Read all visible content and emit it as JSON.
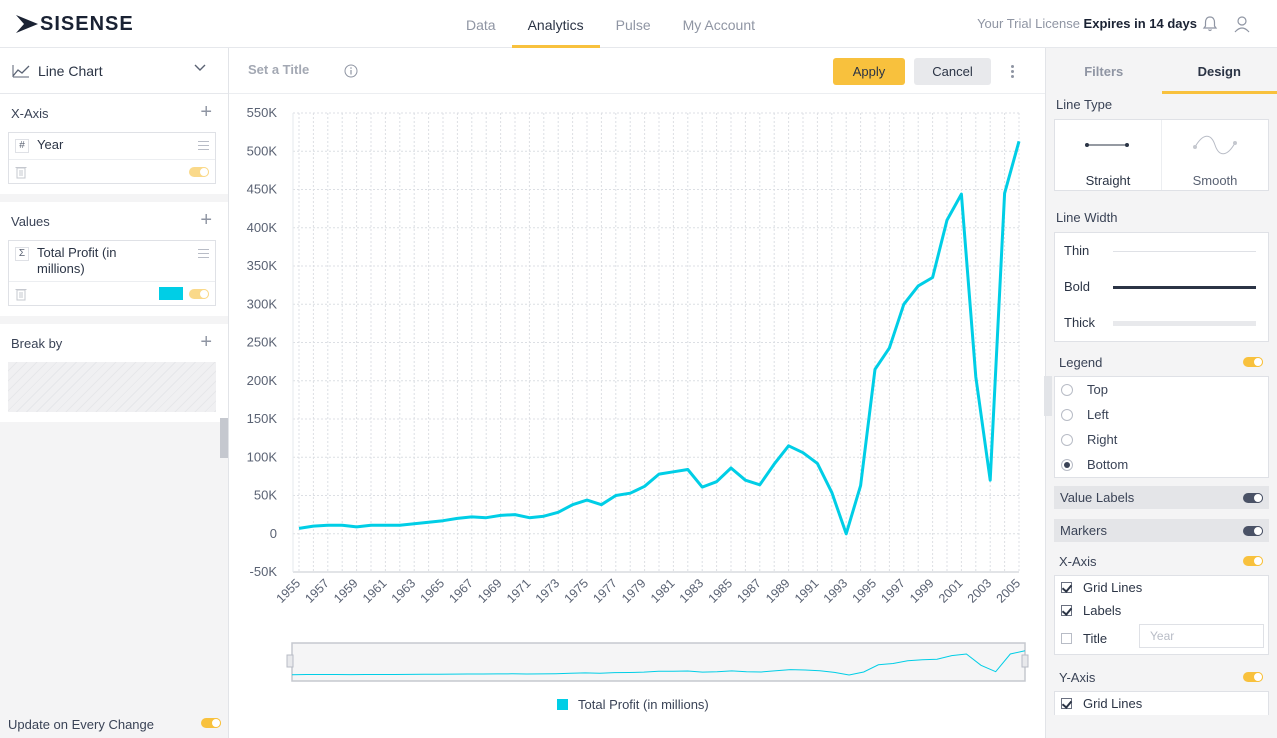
{
  "app": {
    "logo_text": "SISENSE",
    "nav": [
      "Data",
      "Analytics",
      "Pulse",
      "My Account"
    ],
    "active_nav": "Analytics",
    "license_prefix": "Your Trial License ",
    "license_bold": "Expires in 14 days"
  },
  "left": {
    "chart_type": "Line Chart",
    "xaxis_label": "X-Axis",
    "xaxis_field": "Year",
    "xaxis_field_type": "#",
    "values_label": "Values",
    "values_field": "Total Profit (in millions)",
    "values_field_type": "Σ",
    "series_color": "#00cee6",
    "breakby_label": "Break by",
    "update_label": "Update on Every Change"
  },
  "toolbar": {
    "title_placeholder": "Set a Title",
    "apply": "Apply",
    "cancel": "Cancel"
  },
  "design": {
    "tabs": [
      "Filters",
      "Design"
    ],
    "active_tab": "Design",
    "line_type_label": "Line Type",
    "line_types": [
      "Straight",
      "Smooth"
    ],
    "line_width_label": "Line Width",
    "line_widths": [
      "Thin",
      "Bold",
      "Thick"
    ],
    "selected_width": "Bold",
    "legend_label": "Legend",
    "legend_positions": [
      "Top",
      "Left",
      "Right",
      "Bottom"
    ],
    "legend_selected": "Bottom",
    "value_labels": "Value Labels",
    "markers": "Markers",
    "xaxis_label": "X-Axis",
    "xaxis_grid": "Grid Lines",
    "xaxis_labels": "Labels",
    "xaxis_title": "Title",
    "xaxis_title_placeholder": "Year",
    "yaxis_label": "Y-Axis",
    "yaxis_grid": "Grid Lines"
  },
  "chart_data": {
    "type": "line",
    "series": [
      {
        "name": "Total Profit (in millions)",
        "x": [
          1955,
          1956,
          1957,
          1958,
          1959,
          1960,
          1961,
          1962,
          1963,
          1964,
          1965,
          1966,
          1967,
          1968,
          1969,
          1970,
          1971,
          1972,
          1973,
          1974,
          1975,
          1976,
          1977,
          1978,
          1979,
          1980,
          1981,
          1982,
          1983,
          1984,
          1985,
          1986,
          1987,
          1988,
          1989,
          1990,
          1991,
          1992,
          1993,
          1994,
          1995,
          1996,
          1997,
          1998,
          1999,
          2000,
          2001,
          2002,
          2003,
          2004,
          2005
        ],
        "values": [
          7000,
          10000,
          11000,
          11000,
          9000,
          11000,
          11000,
          11000,
          13000,
          15000,
          17000,
          20000,
          22000,
          21000,
          24000,
          25000,
          21000,
          23000,
          28000,
          38000,
          44000,
          38000,
          50000,
          53000,
          62000,
          78000,
          81000,
          84000,
          61000,
          68000,
          86000,
          70000,
          64000,
          91000,
          115000,
          106000,
          92000,
          54000,
          0,
          63000,
          215000,
          243000,
          300000,
          324000,
          335000,
          410000,
          444000,
          205000,
          70000,
          445000,
          513000
        ]
      }
    ],
    "xticks": [
      "1955",
      "1957",
      "1959",
      "1961",
      "1963",
      "1965",
      "1967",
      "1969",
      "1971",
      "1973",
      "1975",
      "1977",
      "1979",
      "1981",
      "1983",
      "1985",
      "1987",
      "1989",
      "1991",
      "1993",
      "1995",
      "1997",
      "1999",
      "2001",
      "2003",
      "2005"
    ],
    "yticks": [
      "550K",
      "500K",
      "450K",
      "400K",
      "350K",
      "300K",
      "250K",
      "200K",
      "150K",
      "100K",
      "50K",
      "0",
      "-50K"
    ],
    "ylim": [
      -50000,
      550000
    ],
    "xlim": [
      1955,
      2005
    ],
    "grid": true,
    "legend": "bottom"
  }
}
